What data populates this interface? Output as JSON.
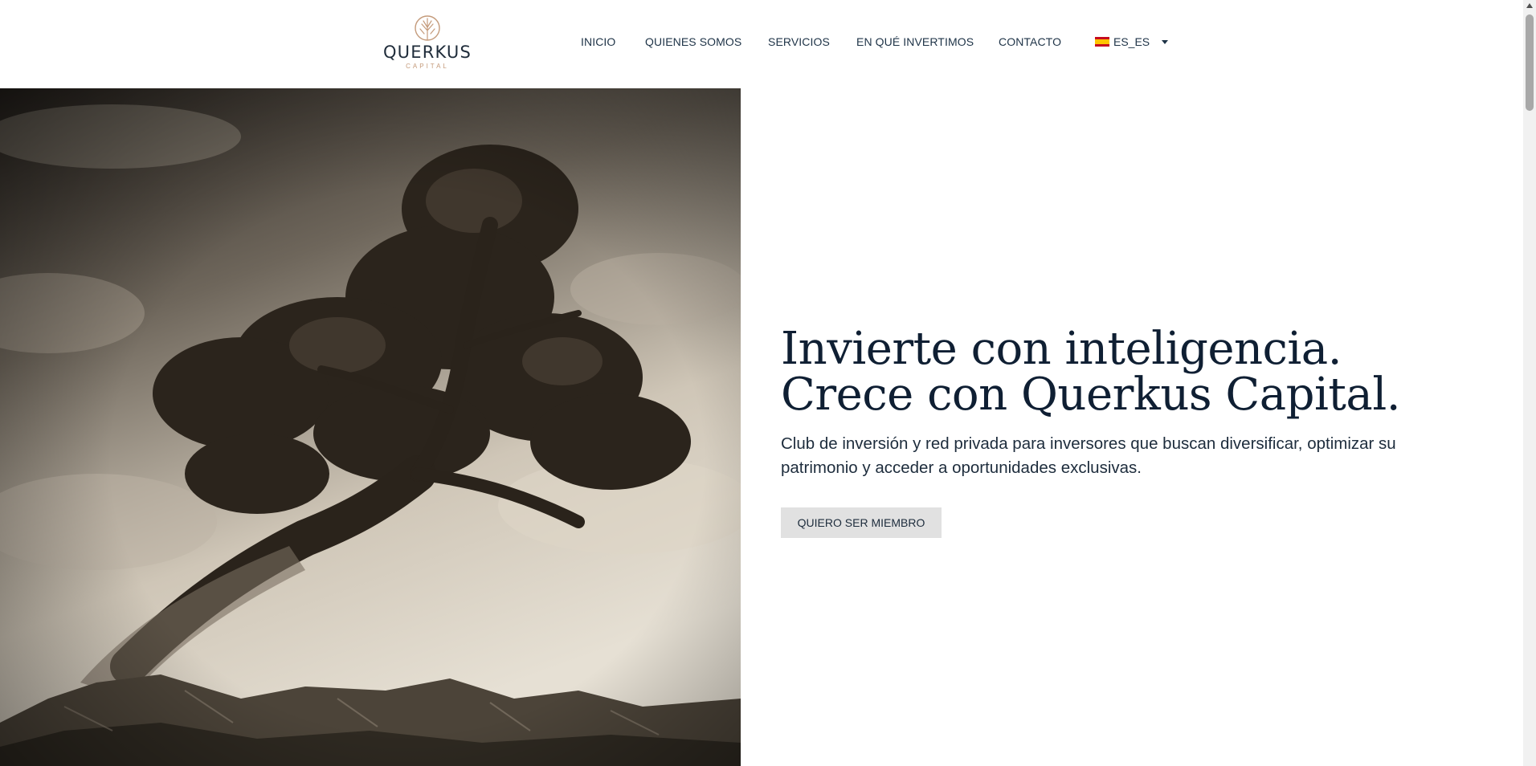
{
  "brand": {
    "name": "QUERKUS",
    "tagline": "CAPITAL",
    "accent_color": "#c49a7a"
  },
  "nav": {
    "items": [
      {
        "label": "INICIO"
      },
      {
        "label": "QUIENES SOMOS"
      },
      {
        "label": "SERVICIOS"
      },
      {
        "label": "EN QUÉ INVERTIMOS"
      },
      {
        "label": "CONTACTO"
      }
    ],
    "language": {
      "label": "ES_ES",
      "flag_icon": "spain-flag-icon"
    }
  },
  "hero": {
    "image_icon": "tree-landscape-image",
    "title": "Invierte con inteligencia. Crece con Querkus Capital.",
    "subtitle": "Club de inversión y red privada para inversores que buscan diversificar, optimizar su patrimonio y acceder a oportunidades exclusivas.",
    "cta_label": "QUIERO SER MIEMBRO"
  },
  "colors": {
    "text_dark": "#0f1f33",
    "button_bg": "#e1e1e1"
  }
}
